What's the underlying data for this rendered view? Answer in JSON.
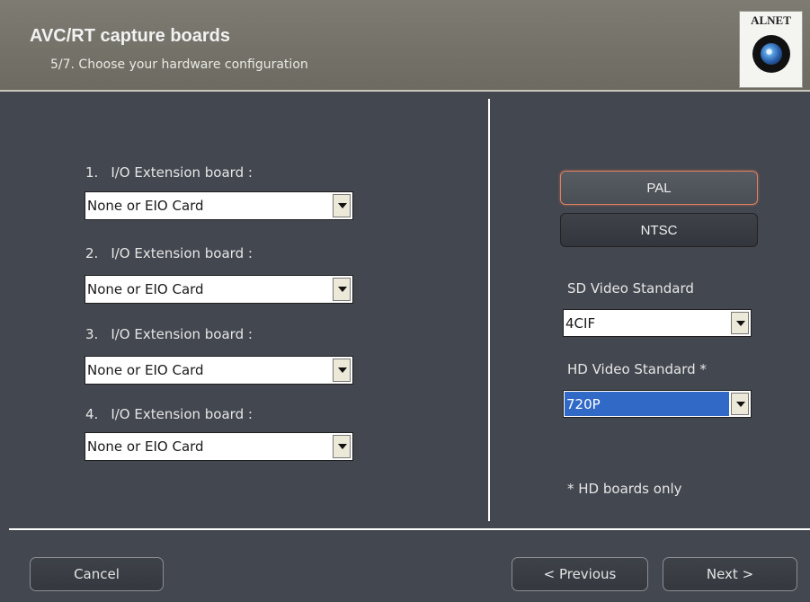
{
  "header": {
    "title": "AVC/RT capture boards",
    "subtitle": "5/7. Choose your hardware configuration",
    "logo_text": "ALNET"
  },
  "boards": [
    {
      "number": "1.",
      "label": "I/O Extension board :",
      "value": "None or EIO Card"
    },
    {
      "number": "2.",
      "label": "I/O Extension board :",
      "value": "None or EIO Card"
    },
    {
      "number": "3.",
      "label": "I/O Extension board :",
      "value": "None or EIO Card"
    },
    {
      "number": "4.",
      "label": "I/O Extension board :",
      "value": "None or EIO Card"
    }
  ],
  "video": {
    "pal_label": "PAL",
    "ntsc_label": "NTSC",
    "selected_standard": "PAL",
    "sd_label": "SD Video Standard",
    "sd_value": "4CIF",
    "hd_label": "HD Video Standard *",
    "hd_value": "720P",
    "note": "* HD boards only"
  },
  "footer": {
    "cancel_label": "Cancel",
    "previous_label": "< Previous",
    "next_label": "Next >"
  },
  "colors": {
    "background": "#43474f",
    "header": "#75736a",
    "selection": "#3169c6",
    "active_border": "#e08060"
  },
  "icons": {
    "logo": "eye-lens-icon",
    "dropdown": "chevron-down-icon"
  }
}
